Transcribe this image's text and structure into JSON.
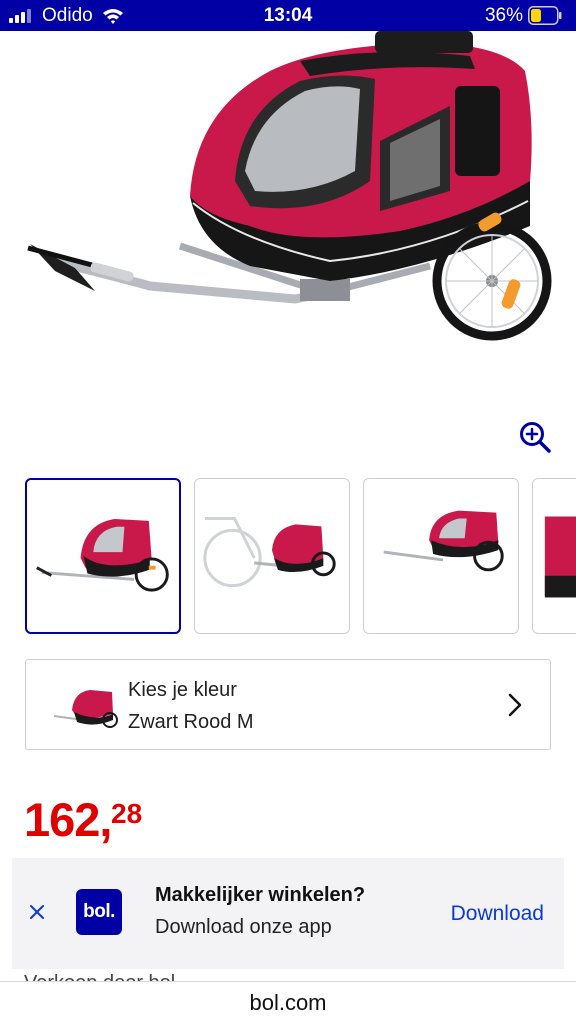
{
  "status_bar": {
    "carrier": "Odido",
    "time": "13:04",
    "battery": "36%"
  },
  "product": {
    "image_alt": "dog bike trailer red black",
    "zoom_icon": "zoom-in-icon"
  },
  "thumbnails": [
    {
      "name": "trailer-side",
      "selected": true
    },
    {
      "name": "trailer-with-bike",
      "selected": false
    },
    {
      "name": "trailer-angle",
      "selected": false
    },
    {
      "name": "trailer-partial",
      "selected": false
    }
  ],
  "color_select": {
    "label": "Kies je kleur",
    "value": "Zwart Rood M",
    "chevron_icon": "chevron-right-icon"
  },
  "price": {
    "euros": "162",
    "separator": ",",
    "cents": "28"
  },
  "app_banner": {
    "logo_text": "bol.",
    "title": "Makkelijker winkelen?",
    "subtitle": "Download onze app",
    "cta": "Download",
    "close_icon": "close-icon"
  },
  "peek_text": "Verkoop door bol",
  "url_bar": {
    "url": "bol.com"
  },
  "colors": {
    "brand_blue": "#0000a4",
    "price_red": "#e00000",
    "link_blue": "#0b3bd3"
  }
}
